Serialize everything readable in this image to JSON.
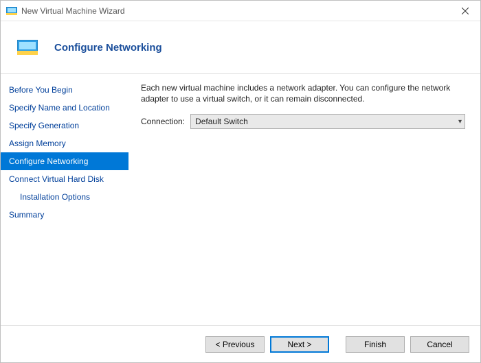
{
  "window": {
    "title": "New Virtual Machine Wizard"
  },
  "header": {
    "title": "Configure Networking"
  },
  "sidebar": {
    "steps": [
      {
        "label": "Before You Begin"
      },
      {
        "label": "Specify Name and Location"
      },
      {
        "label": "Specify Generation"
      },
      {
        "label": "Assign Memory"
      },
      {
        "label": "Configure Networking"
      },
      {
        "label": "Connect Virtual Hard Disk"
      },
      {
        "label": "Installation Options"
      },
      {
        "label": "Summary"
      }
    ],
    "active_index": 4
  },
  "content": {
    "description": "Each new virtual machine includes a network adapter. You can configure the network adapter to use a virtual switch, or it can remain disconnected.",
    "connection_label": "Connection:",
    "connection_value": "Default Switch"
  },
  "footer": {
    "previous": "< Previous",
    "next": "Next >",
    "finish": "Finish",
    "cancel": "Cancel"
  },
  "icons": {
    "app": "vm-wizard-icon",
    "close": "close-icon",
    "chevron": "chevron-down-icon"
  }
}
